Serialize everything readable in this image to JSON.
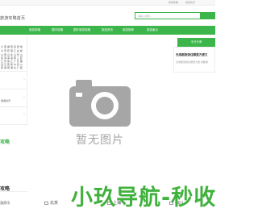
{
  "top_bar": {
    "link1": "旅游攻略",
    "link2": "旅游资讯"
  },
  "header": {
    "logo_text": "旅游攻略首页",
    "search_placeholder": "请输入搜索..."
  },
  "nav": {
    "items": [
      "旅游攻略",
      "国内攻略",
      "国外旅游攻略",
      "旅游资讯",
      "旅游推荐",
      "旅游景点"
    ]
  },
  "sidebar": {
    "block1": [
      "大 西 湖 西 溪 湿 地",
      "大 草 原 丽 江 古 城",
      "山 黄 山 泰 山 华 山",
      "泉 洱 海 海 南 三 亚",
      "江 苏 浙 江 广 东 福",
      "岛 云 南 贵 州 四 川",
      "家 湖 南 湖 北 广 西",
      "国 外 旅 游 攻 略"
    ],
    "block3": [
      "旅游资讯",
      "旅游推荐"
    ]
  },
  "banner": {
    "placeholder_text": "暂无图片"
  },
  "right_panel": {
    "title": "今日头条",
    "headline": "无成都旅游住哪里方便又",
    "desc": "无成都旅游住哪里方便 成都旅"
  },
  "sections": {
    "strategy_green": "攻略",
    "strategy_dark": "攻略",
    "news_left": "游资讯"
  },
  "cities": [
    "北京",
    "上海",
    "四川"
  ],
  "watermark": "小玖导航-秒收"
}
